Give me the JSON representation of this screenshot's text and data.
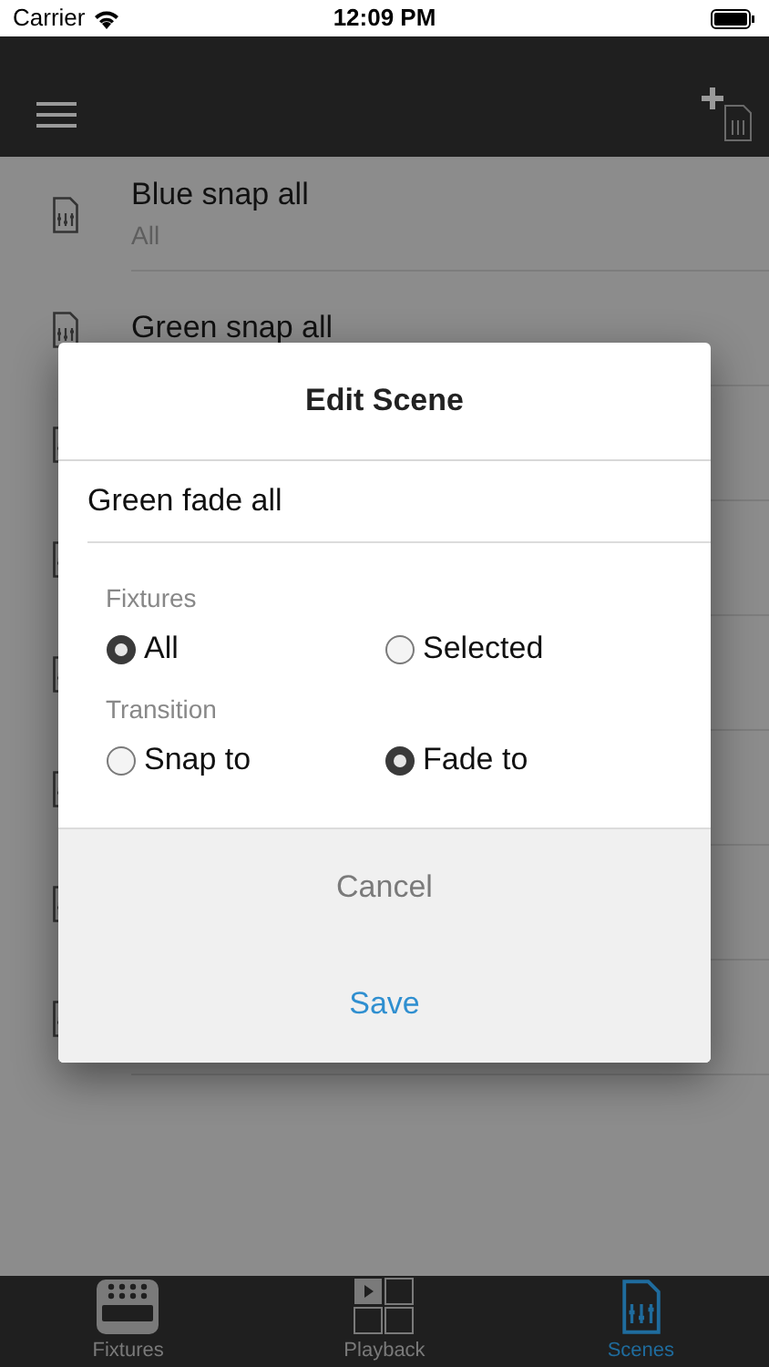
{
  "status_bar": {
    "carrier": "Carrier",
    "time": "12:09 PM"
  },
  "scenes": [
    {
      "kind": "named",
      "title": "Blue snap all",
      "subtitle": "All"
    },
    {
      "kind": "named",
      "title": "Green snap all"
    },
    {
      "kind": "covered"
    },
    {
      "kind": "covered"
    },
    {
      "kind": "covered"
    },
    {
      "kind": "covered"
    },
    {
      "kind": "covered"
    },
    {
      "kind": "covered"
    }
  ],
  "dialog": {
    "title": "Edit Scene",
    "name_value": "Green fade all",
    "groups": [
      {
        "label": "Fixtures",
        "options": [
          {
            "label": "All",
            "selected": true
          },
          {
            "label": "Selected",
            "selected": false
          }
        ]
      },
      {
        "label": "Transition",
        "options": [
          {
            "label": "Snap to",
            "selected": false
          },
          {
            "label": "Fade to",
            "selected": true
          }
        ]
      }
    ],
    "buttons": [
      {
        "label": "Cancel",
        "kind": "cancel"
      },
      {
        "label": "Save",
        "kind": "confirm"
      }
    ]
  },
  "tabs": [
    {
      "label": "Fixtures",
      "kind": "fixtures",
      "selected": false
    },
    {
      "label": "Playback",
      "kind": "playback",
      "selected": false
    },
    {
      "label": "Scenes",
      "kind": "scenes",
      "selected": true
    }
  ]
}
